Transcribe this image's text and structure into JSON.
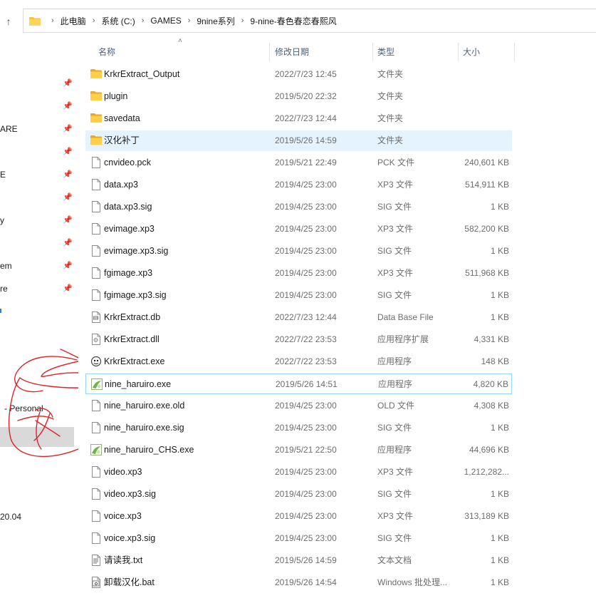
{
  "address": {
    "up_icon": "arrow-up-icon",
    "crumbs": [
      "此电脑",
      "系统 (C:)",
      "GAMES",
      "9nine系列",
      "9-nine-春色春恋春熙风"
    ]
  },
  "nav": {
    "labels": [
      {
        "text": "ARE"
      },
      {
        "text": "E"
      },
      {
        "text": "y"
      },
      {
        "text": "em"
      },
      {
        "text": "re"
      },
      {
        "text": "- Personal"
      },
      {
        "text": "20.04"
      }
    ]
  },
  "columns": {
    "name": "名称",
    "date": "修改日期",
    "type": "类型",
    "size": "大小"
  },
  "files": [
    {
      "name": "KrkrExtract_Output",
      "date": "2022/7/23 12:45",
      "type": "文件夹",
      "size": "",
      "icon": "folder-icon"
    },
    {
      "name": "plugin",
      "date": "2019/5/20 22:32",
      "type": "文件夹",
      "size": "",
      "icon": "folder-icon"
    },
    {
      "name": "savedata",
      "date": "2022/7/23 12:44",
      "type": "文件夹",
      "size": "",
      "icon": "folder-icon"
    },
    {
      "name": "汉化补丁",
      "date": "2019/5/26 14:59",
      "type": "文件夹",
      "size": "",
      "icon": "folder-icon"
    },
    {
      "name": "cnvideo.pck",
      "date": "2019/5/21 22:49",
      "type": "PCK 文件",
      "size": "240,601 KB",
      "icon": "file-icon"
    },
    {
      "name": "data.xp3",
      "date": "2019/4/25 23:00",
      "type": "XP3 文件",
      "size": "514,911 KB",
      "icon": "file-icon"
    },
    {
      "name": "data.xp3.sig",
      "date": "2019/4/25 23:00",
      "type": "SIG 文件",
      "size": "1 KB",
      "icon": "file-icon"
    },
    {
      "name": "evimage.xp3",
      "date": "2019/4/25 23:00",
      "type": "XP3 文件",
      "size": "582,200 KB",
      "icon": "file-icon"
    },
    {
      "name": "evimage.xp3.sig",
      "date": "2019/4/25 23:00",
      "type": "SIG 文件",
      "size": "1 KB",
      "icon": "file-icon"
    },
    {
      "name": "fgimage.xp3",
      "date": "2019/4/25 23:00",
      "type": "XP3 文件",
      "size": "511,968 KB",
      "icon": "file-icon"
    },
    {
      "name": "fgimage.xp3.sig",
      "date": "2019/4/25 23:00",
      "type": "SIG 文件",
      "size": "1 KB",
      "icon": "file-icon"
    },
    {
      "name": "KrkrExtract.db",
      "date": "2022/7/23 12:44",
      "type": "Data Base File",
      "size": "1 KB",
      "icon": "database-file-icon"
    },
    {
      "name": "KrkrExtract.dll",
      "date": "2022/7/22 23:53",
      "type": "应用程序扩展",
      "size": "4,331 KB",
      "icon": "dll-file-icon"
    },
    {
      "name": "KrkrExtract.exe",
      "date": "2022/7/22 23:53",
      "type": "应用程序",
      "size": "148 KB",
      "icon": "krkr-app-icon"
    },
    {
      "name": "nine_haruiro.exe",
      "date": "2019/5/26 14:51",
      "type": "应用程序",
      "size": "4,820 KB",
      "icon": "game-app-icon"
    },
    {
      "name": "nine_haruiro.exe.old",
      "date": "2019/4/25 23:00",
      "type": "OLD 文件",
      "size": "4,308 KB",
      "icon": "file-icon"
    },
    {
      "name": "nine_haruiro.exe.sig",
      "date": "2019/4/25 23:00",
      "type": "SIG 文件",
      "size": "1 KB",
      "icon": "file-icon"
    },
    {
      "name": "nine_haruiro_CHS.exe",
      "date": "2019/5/21 22:50",
      "type": "应用程序",
      "size": "44,696 KB",
      "icon": "game-app-icon"
    },
    {
      "name": "video.xp3",
      "date": "2019/4/25 23:00",
      "type": "XP3 文件",
      "size": "1,212,282...",
      "icon": "file-icon"
    },
    {
      "name": "video.xp3.sig",
      "date": "2019/4/25 23:00",
      "type": "SIG 文件",
      "size": "1 KB",
      "icon": "file-icon"
    },
    {
      "name": "voice.xp3",
      "date": "2019/4/25 23:00",
      "type": "XP3 文件",
      "size": "313,189 KB",
      "icon": "file-icon"
    },
    {
      "name": "voice.xp3.sig",
      "date": "2019/4/25 23:00",
      "type": "SIG 文件",
      "size": "1 KB",
      "icon": "file-icon"
    },
    {
      "name": "请读我.txt",
      "date": "2019/5/26 14:59",
      "type": "文本文档",
      "size": "1 KB",
      "icon": "text-file-icon"
    },
    {
      "name": "卸载汉化.bat",
      "date": "2019/5/26 14:54",
      "type": "Windows 批处理...",
      "size": "1 KB",
      "icon": "batch-file-icon"
    }
  ],
  "colors": {
    "hover_row": "#e5f3ff",
    "focus_border": "#99d1ff",
    "folder": "#f6c443",
    "annotation_ink": "#d9252a"
  }
}
